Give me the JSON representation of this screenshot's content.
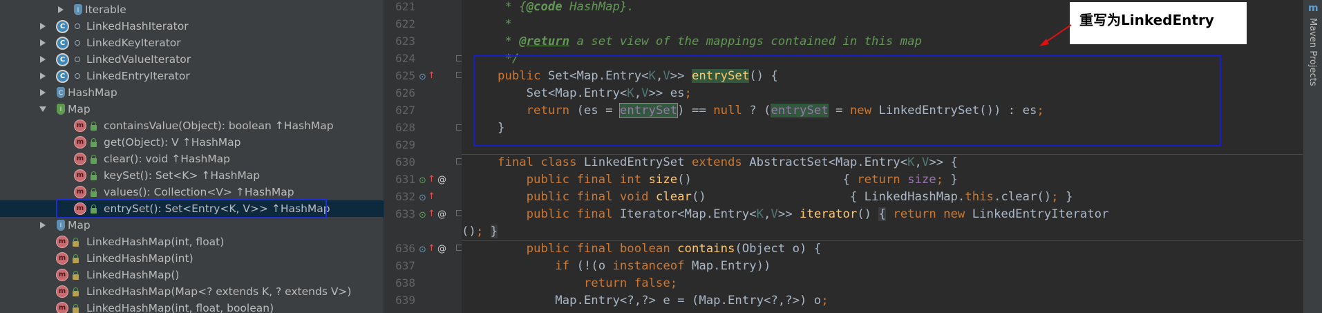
{
  "structure": {
    "items": [
      {
        "label": "Iterable",
        "ret": "",
        "inherited": ""
      },
      {
        "label": "LinkedHashIterator",
        "ret": "",
        "inherited": ""
      },
      {
        "label": "LinkedKeyIterator",
        "ret": "",
        "inherited": ""
      },
      {
        "label": "LinkedValueIterator",
        "ret": "",
        "inherited": ""
      },
      {
        "label": "LinkedEntryIterator",
        "ret": "",
        "inherited": ""
      },
      {
        "label": "HashMap",
        "ret": "",
        "inherited": ""
      },
      {
        "label": "Map",
        "ret": "",
        "inherited": ""
      },
      {
        "label": "containsValue(Object)",
        "ret": ": boolean",
        "inherited": "↑HashMap"
      },
      {
        "label": "get(Object)",
        "ret": ": V",
        "inherited": "↑HashMap"
      },
      {
        "label": "clear()",
        "ret": ": void",
        "inherited": "↑HashMap"
      },
      {
        "label": "keySet()",
        "ret": ": Set<K>",
        "inherited": "↑HashMap"
      },
      {
        "label": "values()",
        "ret": ": Collection<V>",
        "inherited": "↑HashMap"
      },
      {
        "label": "entrySet()",
        "ret": ": Set<Entry<K, V>>",
        "inherited": "↑HashMap"
      },
      {
        "label": "Map",
        "ret": "",
        "inherited": ""
      },
      {
        "label": "LinkedHashMap(int, float)",
        "ret": "",
        "inherited": ""
      },
      {
        "label": "LinkedHashMap(int)",
        "ret": "",
        "inherited": ""
      },
      {
        "label": "LinkedHashMap()",
        "ret": "",
        "inherited": ""
      },
      {
        "label": "LinkedHashMap(Map<? extends K, ? extends V>)",
        "ret": "",
        "inherited": ""
      },
      {
        "label": "LinkedHashMap(int, float, boolean)",
        "ret": "",
        "inherited": ""
      }
    ],
    "selected_index": 12
  },
  "gutter": {
    "line_numbers": [
      "621",
      "622",
      "623",
      "624",
      "625",
      "626",
      "627",
      "628",
      "629",
      "630",
      "631",
      "632",
      "633",
      "",
      "636",
      "637",
      "638",
      "639"
    ]
  },
  "annotation": {
    "text": "重写为LinkedEntry",
    "arrow_color": "#e01010"
  },
  "right_panel": {
    "icon": "m",
    "label": "Maven Projects"
  },
  "colors": {
    "keyword": "#cc7832",
    "comment": "#629755",
    "method": "#ffc66d",
    "field": "#9876aa",
    "type_param": "#507874",
    "highlight": "#32593d",
    "box": "#1620c8"
  }
}
